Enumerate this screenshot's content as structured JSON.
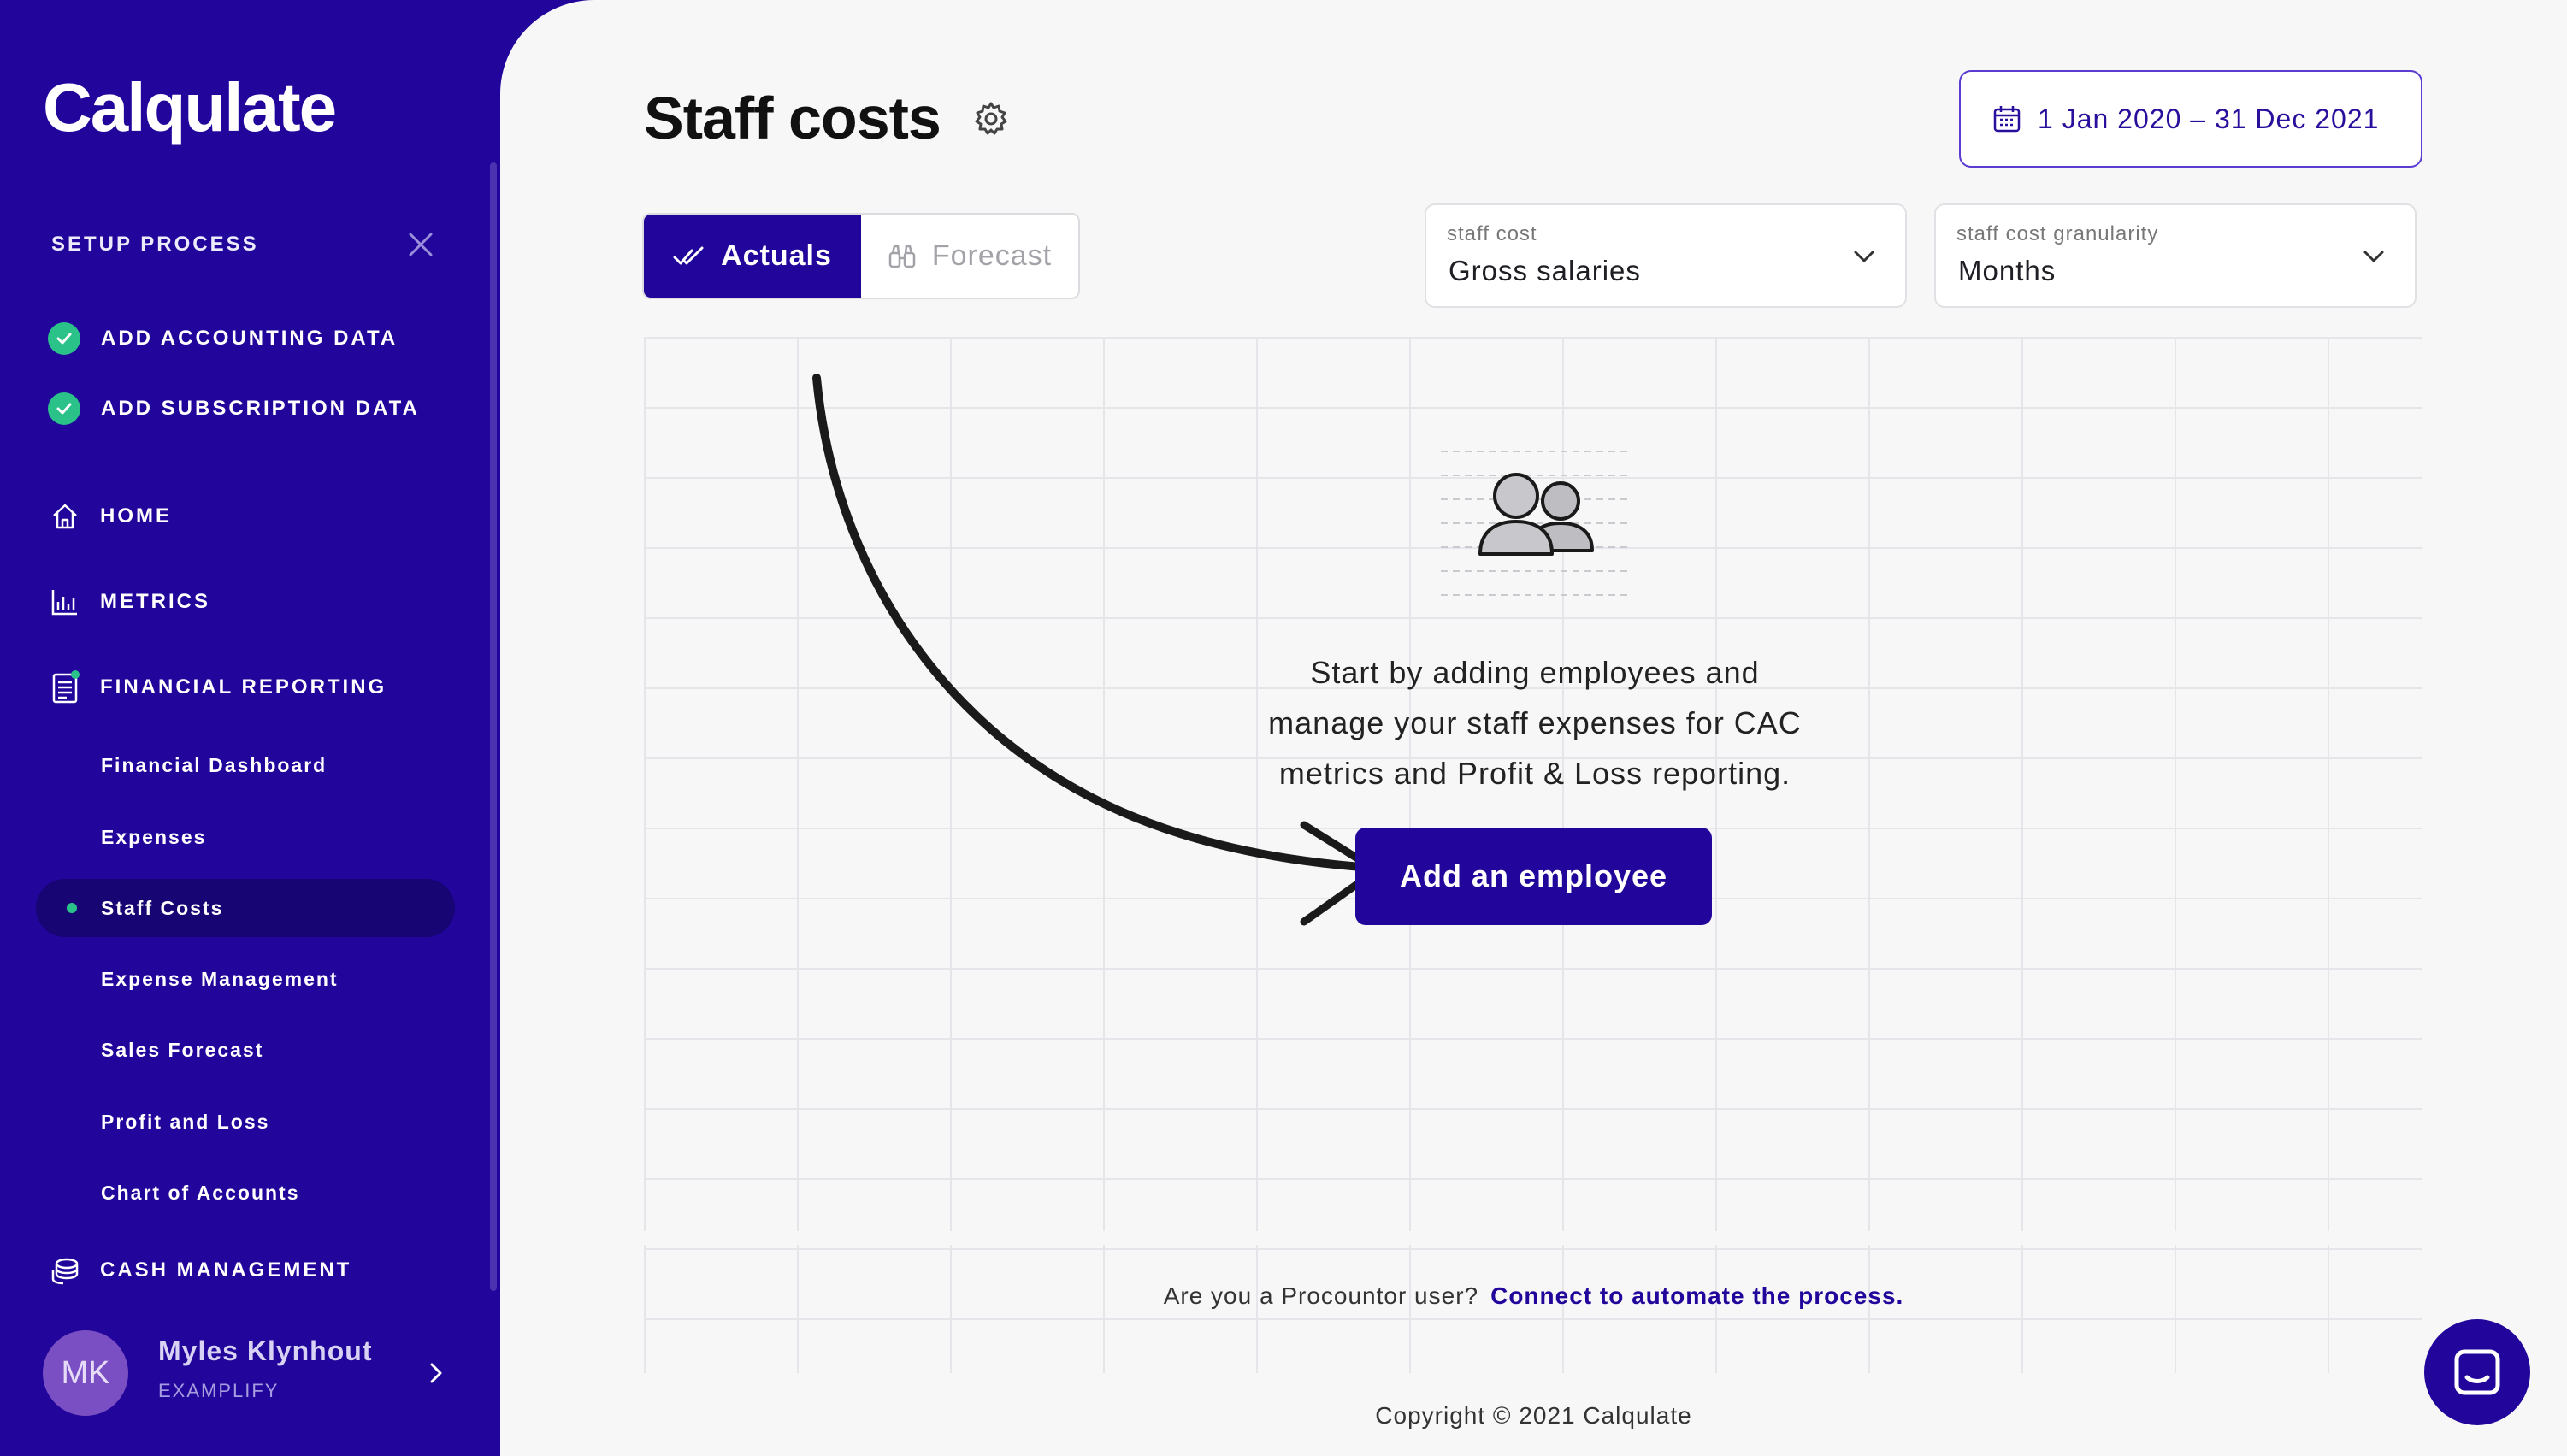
{
  "app": {
    "logo": "Calqulate"
  },
  "sidebar": {
    "setup_title": "SETUP PROCESS",
    "setup_items": [
      {
        "label": "ADD ACCOUNTING DATA",
        "done": true
      },
      {
        "label": "ADD SUBSCRIPTION DATA",
        "done": true
      }
    ],
    "nav": {
      "home": "HOME",
      "metrics": "METRICS",
      "financial_reporting": "FINANCIAL REPORTING",
      "cash_management": "CASH MANAGEMENT"
    },
    "financial_sub": [
      "Financial Dashboard",
      "Expenses",
      "Staff Costs",
      "Expense Management",
      "Sales Forecast",
      "Profit and Loss",
      "Chart of Accounts"
    ],
    "active_sub": "Staff Costs",
    "user": {
      "initials": "MK",
      "name": "Myles Klynhout",
      "org": "EXAMPLIFY"
    }
  },
  "header": {
    "title": "Staff costs",
    "date_range": "1 Jan 2020 – 31 Dec 2021"
  },
  "toggle": {
    "actuals": "Actuals",
    "forecast": "Forecast",
    "active": "actuals"
  },
  "filters": {
    "staff_cost": {
      "label": "staff cost",
      "value": "Gross salaries"
    },
    "granularity": {
      "label": "staff cost granularity",
      "value": "Months"
    }
  },
  "empty_state": {
    "line1": "Start by adding employees and",
    "line2": "manage your staff expenses for CAC",
    "line3": "metrics and Profit & Loss reporting.",
    "button": "Add an employee"
  },
  "footer": {
    "procountor_question": "Are you a Procountor user?",
    "procountor_link": "Connect to automate the process.",
    "copyright": "Copyright © 2021 Calqulate"
  },
  "colors": {
    "brand": "#22059a",
    "success": "#2bc28a",
    "background": "#f7f7f8"
  }
}
